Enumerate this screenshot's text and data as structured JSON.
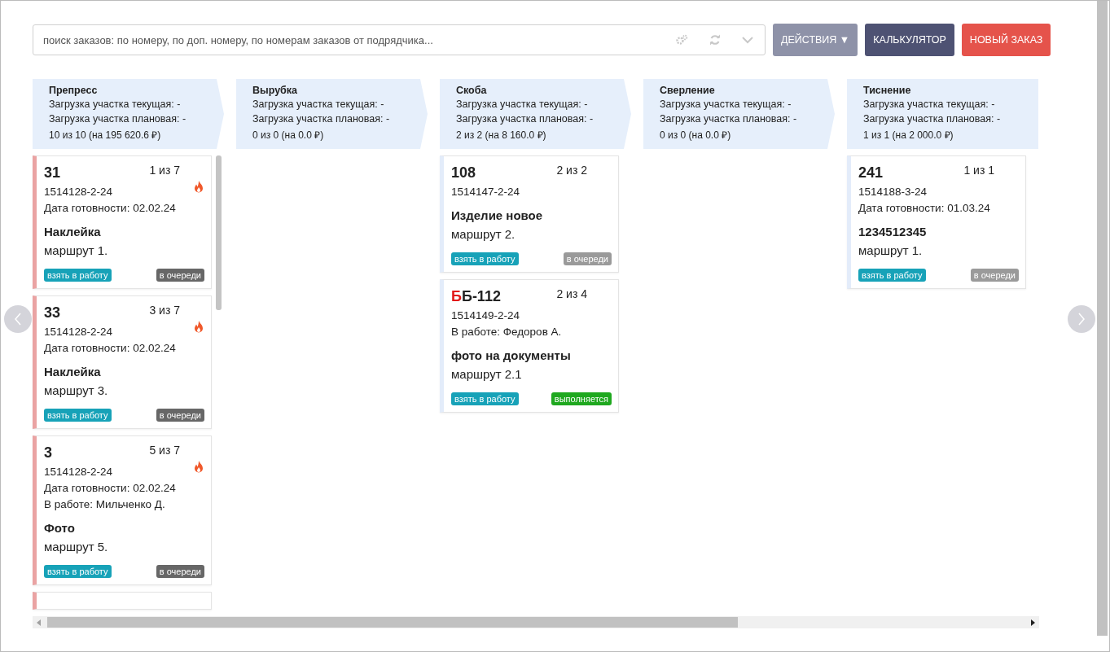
{
  "search": {
    "placeholder": "поиск заказов: по номеру, по доп. номеру, по номерам заказов от подрядчика..."
  },
  "buttons": [
    {
      "label": "ДЕЙСТВИЯ ▼",
      "kind": "actions"
    },
    {
      "label": "КАЛЬКУЛЯТОР",
      "kind": "calculator"
    },
    {
      "label": "НОВЫЙ ЗАКАЗ",
      "kind": "new"
    }
  ],
  "columns": [
    {
      "title": "Препресс",
      "load_current": "Загрузка участка текущая: -",
      "load_planned": "Загрузка участка плановая: -",
      "summary": "10 из 10 (на 195 620.6 ₽)",
      "scrollable": true,
      "cards": [
        {
          "number": "31",
          "count": "1 из 7",
          "code": "1514128-2-24",
          "date": "Дата готовности: 02.02.24",
          "urgent": true,
          "color": "#eaa3a3",
          "product": "Наклейка",
          "route": "маршрут 1.",
          "take": "взять в работу",
          "status": {
            "label": "в очереди",
            "color": "#676767"
          }
        },
        {
          "number": "33",
          "count": "3 из 7",
          "code": "1514128-2-24",
          "date": "Дата готовности: 02.02.24",
          "urgent": true,
          "color": "#eaa3a3",
          "product": "Наклейка",
          "route": "маршрут 3.",
          "take": "взять в работу",
          "status": {
            "label": "в очереди",
            "color": "#676767"
          }
        },
        {
          "number": "3",
          "count": "5 из 7",
          "code": "1514128-2-24",
          "date": "Дата готовности: 02.02.24",
          "worker": "В работе: Мильченко Д.",
          "urgent": true,
          "color": "#eaa3a3",
          "product": "Фото",
          "route": "маршрут 5.",
          "take": "взять в работу",
          "status": {
            "label": "в очереди",
            "color": "#676767"
          }
        }
      ]
    },
    {
      "title": "Вырубка",
      "load_current": "Загрузка участка текущая: -",
      "load_planned": "Загрузка участка плановая: -",
      "summary": "0 из 0 (на 0.0 ₽)"
    },
    {
      "title": "Скоба",
      "load_current": "Загрузка участка текущая: -",
      "load_planned": "Загрузка участка плановая: -",
      "summary": "2 из 2 (на 8 160.0 ₽)",
      "cards": [
        {
          "number": "108",
          "count": "2 из 2",
          "code": "1514147-2-24",
          "urgent": false,
          "color": "#e3ecfa",
          "product": "Изделие новое",
          "route": "маршрут 2.",
          "take": "взять в работу",
          "status": {
            "label": "в очереди",
            "color": "#9a9a9a"
          }
        },
        {
          "prefix": "Б",
          "number": "Б-112",
          "count": "2 из 4",
          "code": "1514149-2-24",
          "worker": "В работе: Федоров А.",
          "urgent": false,
          "color": "#e3ecfa",
          "product": "фото на документы",
          "route": "маршрут 2.1",
          "take": "взять в работу",
          "status": {
            "label": "выполняется",
            "color": "#1fa81f"
          }
        }
      ]
    },
    {
      "title": "Сверление",
      "load_current": "Загрузка участка текущая: -",
      "load_planned": "Загрузка участка плановая: -",
      "summary": "0 из 0 (на 0.0 ₽)"
    },
    {
      "title": "Тиснение",
      "load_current": "Загрузка участка текущая: -",
      "load_planned": "Загрузка участка плановая: -",
      "summary": "1 из 1 (на 2 000.0 ₽)",
      "cards": [
        {
          "number": "241",
          "count": "1 из 1",
          "code": "1514188-3-24",
          "date": "Дата готовности: 01.03.24",
          "urgent": false,
          "color": "#e3ecfa",
          "product": "1234512345",
          "route": "маршрут 1.",
          "take": "взять в работу",
          "status": {
            "label": "в очереди",
            "color": "#9a9a9a"
          }
        }
      ]
    }
  ]
}
